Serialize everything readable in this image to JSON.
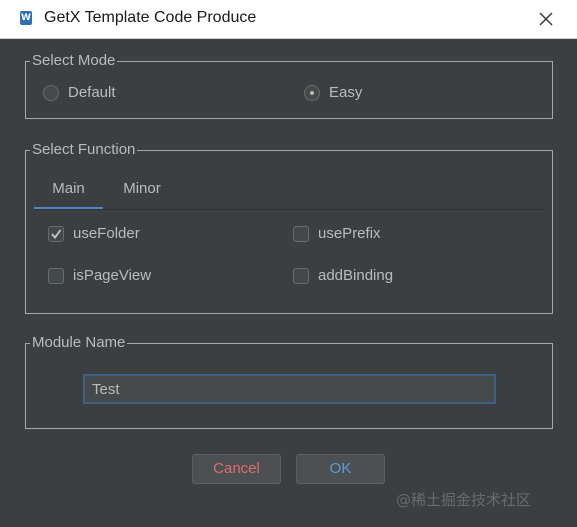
{
  "window": {
    "title": "GetX Template Code Produce",
    "app_icon_letter": "W"
  },
  "select_mode": {
    "legend": "Select Mode",
    "options": [
      {
        "label": "Default",
        "selected": false
      },
      {
        "label": "Easy",
        "selected": true
      }
    ]
  },
  "select_function": {
    "legend": "Select Function",
    "tabs": [
      {
        "label": "Main",
        "active": true
      },
      {
        "label": "Minor",
        "active": false
      }
    ],
    "checkboxes": [
      {
        "label": "useFolder",
        "checked": true
      },
      {
        "label": "usePrefix",
        "checked": false
      },
      {
        "label": "isPageView",
        "checked": false
      },
      {
        "label": "addBinding",
        "checked": false
      }
    ]
  },
  "module_name": {
    "legend": "Module Name",
    "value": "Test"
  },
  "buttons": {
    "cancel": "Cancel",
    "ok": "OK"
  },
  "watermark": "@稀土掘金技术社区",
  "colors": {
    "background": "#3c3f41",
    "accent": "#4a88c7",
    "cancel_text": "#e06c6c",
    "ok_text": "#5b9bd5"
  }
}
